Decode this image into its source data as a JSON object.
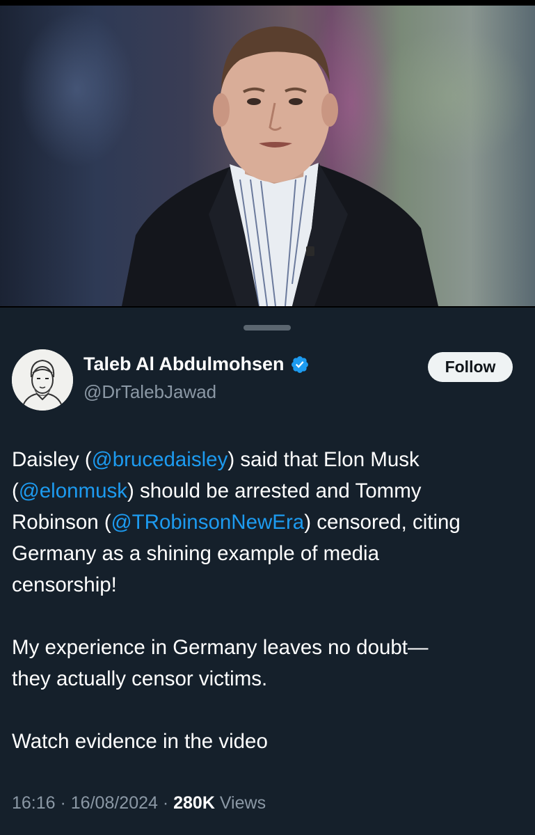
{
  "author": {
    "name": "Taleb Al Abdulmohsen",
    "handle": "@DrTalebJawad",
    "verified": true,
    "verified_color": "#1d9bf0"
  },
  "follow_button": {
    "label": "Follow"
  },
  "tweet": {
    "p1": {
      "t1": "Daisley (",
      "m1": "@brucedaisley",
      "t2": ") said that Elon Musk",
      "t3": "(",
      "m2": "@elonmusk",
      "t4": ") should be arrested and Tommy",
      "t5": "Robinson (",
      "m3": "@TRobinsonNewEra",
      "t6": ") censored, citing",
      "t7": "Germany as a shining example of media",
      "t8": "censorship!"
    },
    "p2": {
      "l1": "My experience in Germany leaves no doubt—",
      "l2": "they actually censor victims."
    },
    "p3": "Watch evidence in the video"
  },
  "meta": {
    "time": "16:16",
    "sep1": " · ",
    "date": "16/08/2024",
    "sep2": " · ",
    "views_count": "280K",
    "views_label": " Views"
  },
  "colors": {
    "background": "#15202b",
    "mention": "#1d9bf0",
    "secondary_text": "#8b98a5"
  }
}
